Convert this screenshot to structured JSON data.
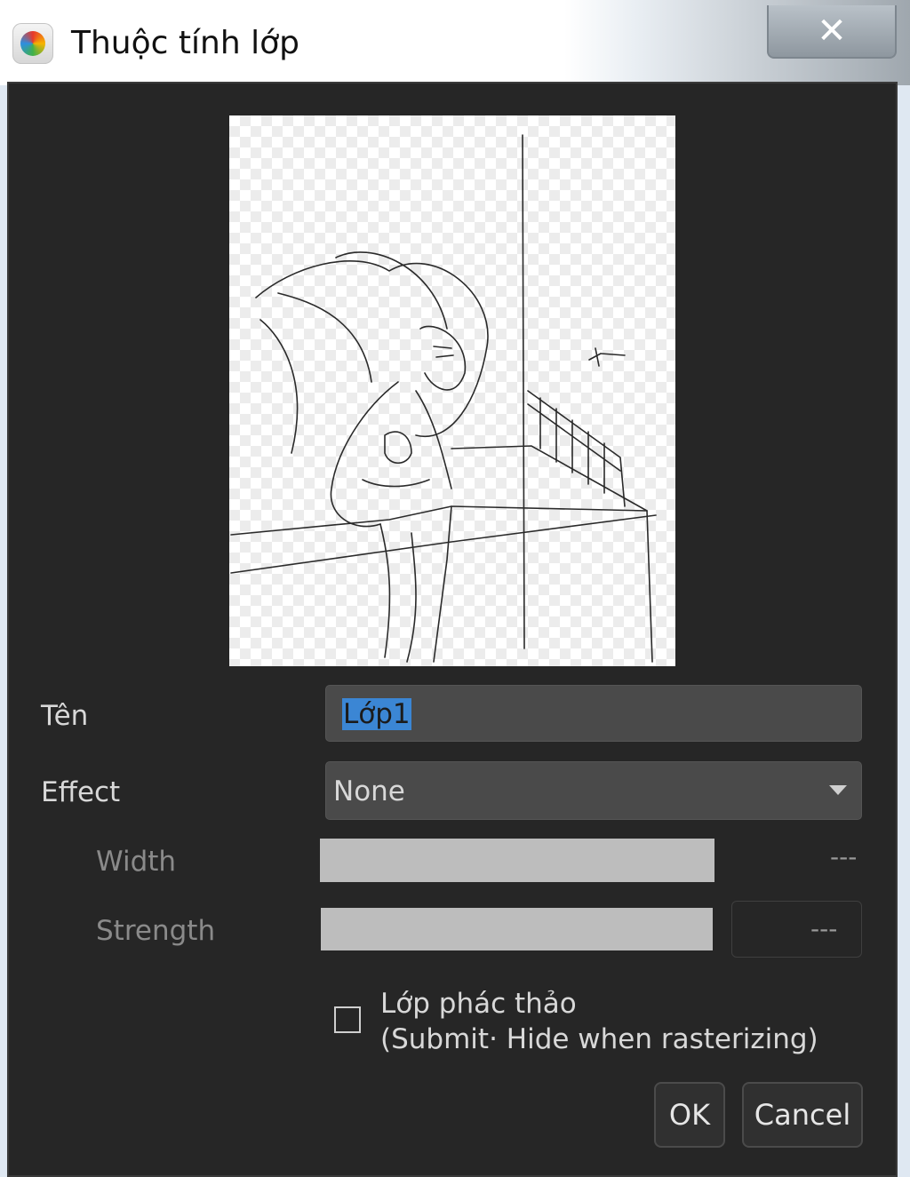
{
  "window": {
    "title": "Thuộc tính lớp",
    "close_glyph": "✕"
  },
  "form": {
    "name_label": "Tên",
    "name_value": "Lớp1",
    "effect_label": "Effect",
    "effect_value": "None",
    "width_label": "Width",
    "width_value": "---",
    "strength_label": "Strength",
    "strength_value": "---",
    "draft_layer_line1": "Lớp phác thảo",
    "draft_layer_line2": "(Submit· Hide when rasterizing)",
    "draft_layer_checked": false
  },
  "buttons": {
    "ok": "OK",
    "cancel": "Cancel"
  },
  "icons": {
    "app": "medibang-color-ball-icon",
    "close": "close-icon",
    "dropdown": "chevron-down-icon"
  }
}
